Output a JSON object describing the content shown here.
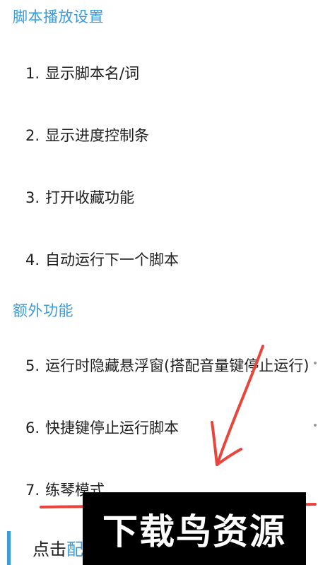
{
  "sections": {
    "playback": {
      "title": "脚本播放设置"
    },
    "extra": {
      "title": "额外功能"
    }
  },
  "items": [
    {
      "num": "1.",
      "label": "显示脚本名/词"
    },
    {
      "num": "2.",
      "label": "显示进度控制条"
    },
    {
      "num": "3.",
      "label": "打开收藏功能"
    },
    {
      "num": "4.",
      "label": "自动运行下一个脚本"
    },
    {
      "num": "5.",
      "label": "运行时隐藏悬浮窗(搭配音量键停止运行)"
    },
    {
      "num": "6.",
      "label": "快捷键停止运行脚本"
    },
    {
      "num": "7.",
      "label": "练琴模式"
    }
  ],
  "bottom": {
    "prefix": "点击",
    "highlight": "配置我的配置"
  },
  "watermark": {
    "text": "下载鸟资源"
  },
  "colors": {
    "accent": "#3a9bd9",
    "annotation": "#e8453c",
    "watermark_bg": "#000000"
  }
}
